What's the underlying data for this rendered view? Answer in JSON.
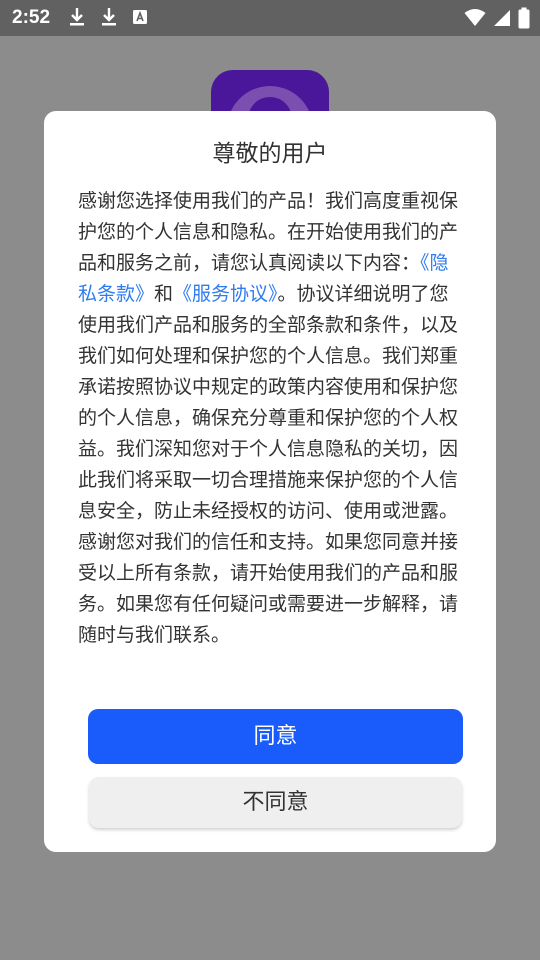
{
  "status_bar": {
    "time": "2:52",
    "icons_left": [
      "download-icon",
      "download-icon",
      "font-a-icon"
    ],
    "icons_right": [
      "wifi-icon",
      "signal-icon",
      "battery-icon"
    ]
  },
  "dialog": {
    "title": "尊敬的用户",
    "body": {
      "text_before_links": "感谢您选择使用我们的产品！我们高度重视保护您的个人信息和隐私。在开始使用我们的产品和服务之前，请您认真阅读以下内容：",
      "privacy_link": "《隐私条款》",
      "and_text": "和",
      "service_link": "《服务协议》",
      "text_after_links": "。协议详细说明了您使用我们产品和服务的全部条款和条件，以及我们如何处理和保护您的个人信息。我们郑重承诺按照协议中规定的政策内容使用和保护您的个人信息，确保充分尊重和保护您的个人权益。我们深知您对于个人信息隐私的关切，因此我们将采取一切合理措施来保护您的个人信息安全，防止未经授权的访问、使用或泄露。感谢您对我们的信任和支持。如果您同意并接受以上所有条款，请开始使用我们的产品和服务。如果您有任何疑问或需要进一步解释，请随时与我们联系。"
    },
    "agree_label": "同意",
    "disagree_label": "不同意"
  },
  "colors": {
    "accent": "#1a5cfb",
    "link": "#2f7cf0",
    "scrim": "#8c8c8c",
    "status_bar": "#616161",
    "app_icon": "#4a169a"
  }
}
